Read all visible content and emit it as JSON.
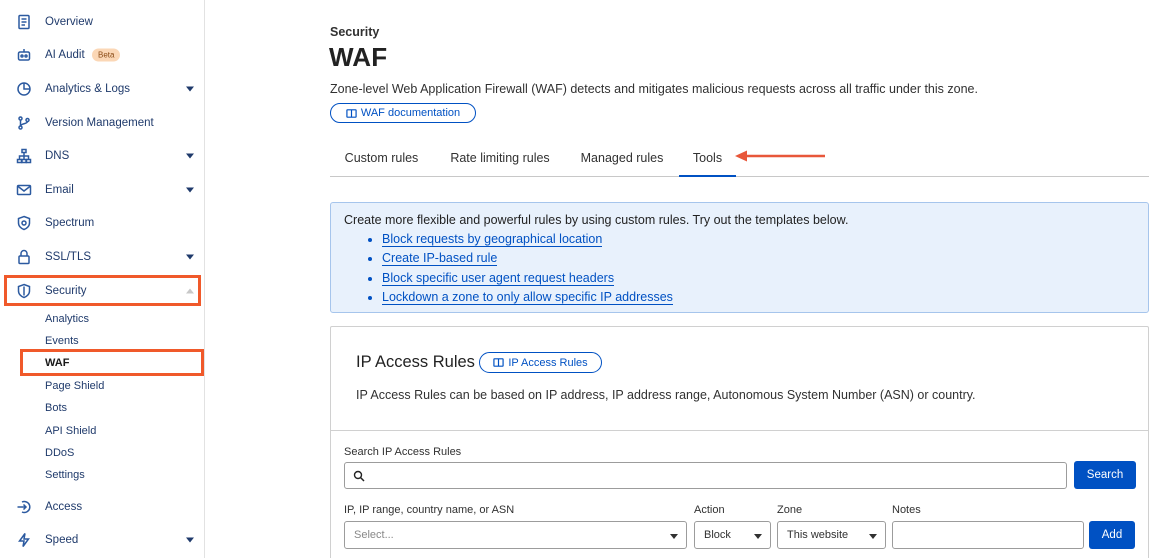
{
  "sidebar": {
    "items": [
      {
        "label": "Overview"
      },
      {
        "label": "AI Audit",
        "badge": "Beta"
      },
      {
        "label": "Analytics & Logs"
      },
      {
        "label": "Version Management"
      },
      {
        "label": "DNS"
      },
      {
        "label": "Email"
      },
      {
        "label": "Spectrum"
      },
      {
        "label": "SSL/TLS"
      },
      {
        "label": "Security"
      },
      {
        "label": "Access"
      },
      {
        "label": "Speed"
      }
    ],
    "security_sub": [
      "Analytics",
      "Events",
      "WAF",
      "Page Shield",
      "Bots",
      "API Shield",
      "DDoS",
      "Settings"
    ],
    "highlight_color": "#f0592a",
    "accent": "#0051c3"
  },
  "header": {
    "breadcrumb": "Security",
    "title": "WAF",
    "description": "Zone-level Web Application Firewall (WAF) detects and mitigates malicious requests across all traffic under this zone.",
    "doc_button": "WAF documentation"
  },
  "tabs": [
    {
      "label": "Custom rules"
    },
    {
      "label": "Rate limiting rules"
    },
    {
      "label": "Managed rules"
    },
    {
      "label": "Tools",
      "active": true
    }
  ],
  "info_box": {
    "text": "Create more flexible and powerful rules by using custom rules. Try out the templates below.",
    "links": [
      "Block requests by geographical location",
      "Create IP-based rule",
      "Block specific user agent request headers",
      "Lockdown a zone to only allow specific IP addresses"
    ]
  },
  "ip_access": {
    "title": "IP Access Rules",
    "doc_button": "IP Access Rules",
    "description": "IP Access Rules can be based on IP address, IP address range, Autonomous System Number (ASN) or country.",
    "search_label": "Search IP Access Rules",
    "search_value": "",
    "search_button": "Search",
    "ip_label": "IP, IP range, country name, or ASN",
    "ip_placeholder": "Select...",
    "action_label": "Action",
    "action_value": "Block",
    "zone_label": "Zone",
    "zone_value": "This website",
    "notes_label": "Notes",
    "notes_value": "",
    "add_button": "Add"
  }
}
